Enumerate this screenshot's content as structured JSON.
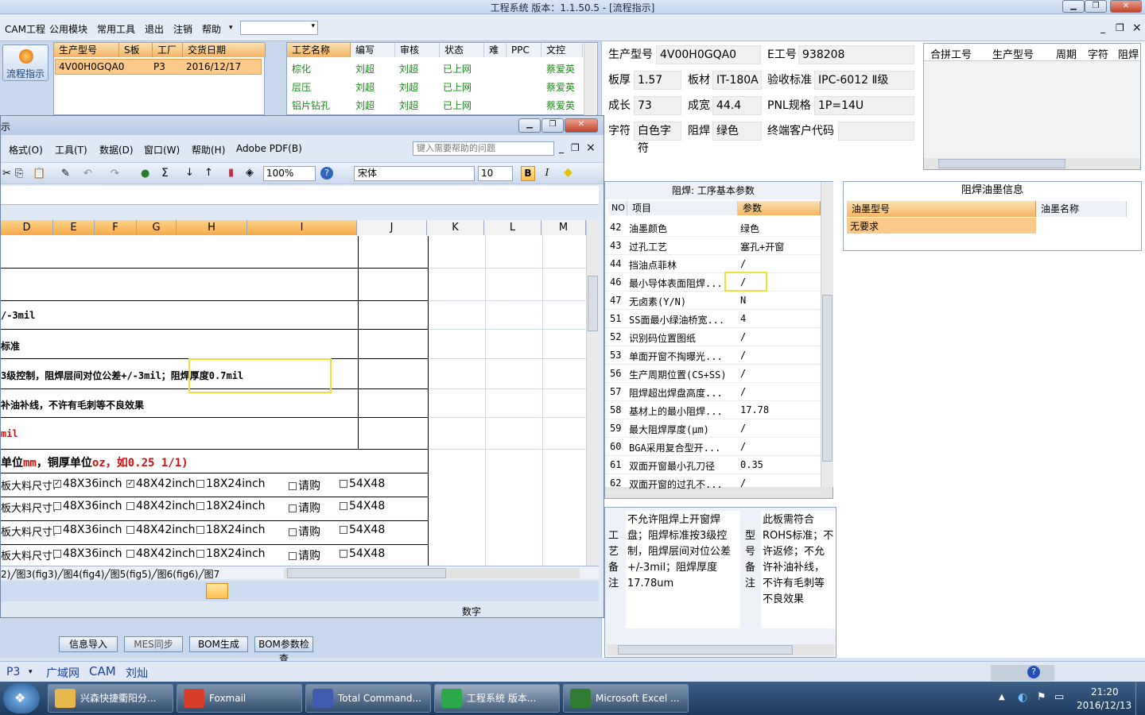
{
  "app": {
    "title": "工程系统    版本：1.1.50.5 - [流程指示]",
    "win_min": "▁",
    "win_max": "❐",
    "win_close": "✕"
  },
  "menu": {
    "items": [
      "CAM工程",
      "公用模块",
      "常用工具",
      "退出",
      "注销",
      "帮助"
    ],
    "mdi_min": "_",
    "mdi_restore": "❐",
    "mdi_close": "×"
  },
  "flow_button": "流程指示",
  "orders": {
    "headers": [
      "生产型号",
      "S板",
      "工厂",
      "交货日期"
    ],
    "row": [
      "4V00H0GQA0",
      "",
      "P3",
      "2016/12/17"
    ]
  },
  "process": {
    "headers": [
      "工艺名称",
      "编写",
      "审核",
      "状态",
      "难",
      "PPC",
      "文控"
    ],
    "rows": [
      [
        "棕化",
        "刘超",
        "刘超",
        "已上网",
        "",
        "",
        "蔡爱英"
      ],
      [
        "层压",
        "刘超",
        "刘超",
        "已上网",
        "",
        "",
        "蔡爱英"
      ],
      [
        "铝片钻孔",
        "刘超",
        "刘超",
        "已上网",
        "",
        "",
        "蔡爱英"
      ]
    ]
  },
  "info": {
    "model_label": "生产型号",
    "model": "4V00H0GQA0",
    "ework_label": "E工号",
    "ework": "938208",
    "thick_label": "板厚",
    "thick": "1.57",
    "mat_label": "板材",
    "mat": "IT-180A",
    "std_label": "验收标准",
    "std": "IPC-6012 Ⅱ级",
    "len_label": "成长",
    "len": "73",
    "wid_label": "成宽",
    "wid": "44.4",
    "pnl_label": "PNL规格",
    "pnl": "1P=14U",
    "char_label": "字符",
    "char": "白色字符",
    "mask_label": "阻焊",
    "mask": "绿色",
    "cust_label": "终端客户代码",
    "cust": ""
  },
  "merge": {
    "headers": [
      "合拼工号",
      "生产型号",
      "周期",
      "字符",
      "阻焊"
    ]
  },
  "params": {
    "title": "阻焊: 工序基本参数",
    "headers": [
      "NO",
      "项目",
      "参数"
    ],
    "rows": [
      [
        "42",
        "油墨颜色",
        "绿色"
      ],
      [
        "43",
        "过孔工艺",
        "塞孔+开窗"
      ],
      [
        "44",
        "挡油点菲林",
        "/"
      ],
      [
        "46",
        "最小导体表面阻焊...",
        "/"
      ],
      [
        "47",
        "无卤素(Y/N)",
        "N"
      ],
      [
        "51",
        "SS面最小绿油桥宽...",
        "4"
      ],
      [
        "52",
        "识别码位置图纸",
        "/"
      ],
      [
        "53",
        "单面开窗不掏曝光...",
        "/"
      ],
      [
        "56",
        "生产周期位置(CS+SS)",
        "/"
      ],
      [
        "57",
        "阻焊超出焊盘高度...",
        "/"
      ],
      [
        "58",
        "基材上的最小阻焊...",
        "17.78"
      ],
      [
        "59",
        "最大阻焊厚度(μm)",
        "/"
      ],
      [
        "60",
        "BGA采用复合型开...",
        "/"
      ],
      [
        "61",
        "双面开窗最小孔刀径",
        "0.35"
      ],
      [
        "62",
        "双面开窗的过孔不...",
        "/"
      ]
    ]
  },
  "ink": {
    "title": "阻焊油墨信息",
    "headers": [
      "油墨型号",
      "油墨名称"
    ],
    "row": [
      "无要求",
      ""
    ]
  },
  "notes": {
    "process_label": [
      "工",
      "艺",
      "备",
      "注"
    ],
    "process_text": "不允许阻焊上开窗焊盘；阻焊标准按3级控制，阻焊层间对位公差+/-3mil；阻焊厚度17.78um",
    "model_label": [
      "型",
      "号",
      "备",
      "注"
    ],
    "model_text": "此板需符合ROHS标准；不许返修；不允许补油补线，不许有毛刺等不良效果"
  },
  "bottom_buttons": [
    "信息导入",
    "MES同步",
    "BOM生成",
    "BOM参数检查"
  ],
  "status": {
    "factory": "P3",
    "net": "广域网",
    "dept": "CAM",
    "user": "刘灿"
  },
  "excel": {
    "title_partial": "示",
    "menus": [
      "格式(O)",
      "工具(T)",
      "数据(D)",
      "窗口(W)",
      "帮助(H)",
      "Adobe PDF(B)"
    ],
    "help_placeholder": "键入需要帮助的问题",
    "zoom": "100%",
    "font": "宋体",
    "font_size": "10",
    "bold": "B",
    "italic": "I",
    "columns": [
      "D",
      "E",
      "F",
      "G",
      "H",
      "I",
      "J",
      "K",
      "L",
      "M"
    ],
    "lines": [
      "/-3mil",
      "标准",
      "3级控制，阻焊层间对位公差+/-3mil；阻焊厚度0.7mil",
      "补油补线，不许有毛刺等不良效果",
      "mil"
    ],
    "unit_note_a": "单位",
    "unit_note_b": "mm",
    "unit_note_c": "，铜厚单位",
    "unit_note_d": "oz",
    "unit_note_e": "，如0.25 1/1)",
    "size_label": "板大料尺寸:",
    "sizes": [
      "48X36inch",
      "48X42inch",
      "18X24inch",
      "请购",
      "54X48"
    ],
    "sheet_tabs": "2)╱图3(fig3)╱图4(fig4)╱图5(fig5)╱图6(fig6)╱图7",
    "status_num": "数字"
  },
  "taskbar": {
    "items": [
      "兴森快捷衢阳分...",
      "Foxmail",
      "Total Command...",
      "工程系统    版本...",
      "Microsoft Excel ..."
    ],
    "time": "21:20",
    "date": "2016/12/13"
  }
}
